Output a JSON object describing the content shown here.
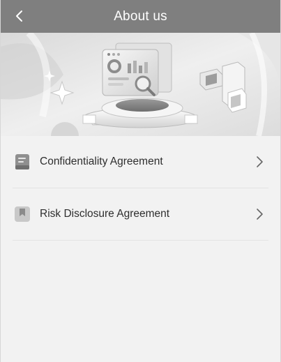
{
  "header": {
    "title": "About us",
    "back_icon": "chevron-left-icon"
  },
  "banner": {
    "image": "dashboard-platform-illustration"
  },
  "items": [
    {
      "label": "Confidentiality Agreement",
      "icon": "document-icon",
      "action_icon": "chevron-right-icon"
    },
    {
      "label": "Risk Disclosure Agreement",
      "icon": "bookmark-icon",
      "action_icon": "chevron-right-icon"
    }
  ],
  "colors": {
    "header_bg": "#7f7f7f",
    "header_text": "#ffffff",
    "page_bg": "#f2f2f2",
    "text": "#2e2e2e",
    "divider": "#e3e3e3"
  }
}
